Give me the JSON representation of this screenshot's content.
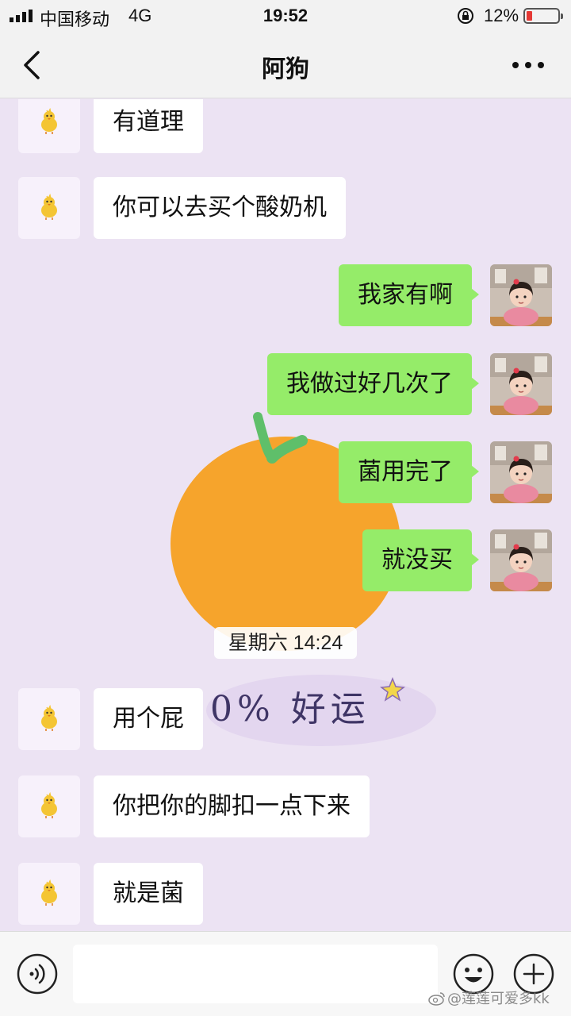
{
  "status_bar": {
    "carrier": "中国移动",
    "network": "4G",
    "time": "19:52",
    "battery_percent": "12%",
    "battery_level": 0.12,
    "battery_color": "#e53935"
  },
  "nav": {
    "title": "阿狗",
    "back_icon": "chevron-left-icon",
    "more_icon": "more-dots-icon"
  },
  "messages": [
    {
      "side": "left",
      "text": "有道理"
    },
    {
      "side": "left",
      "text": "你可以去买个酸奶机"
    },
    {
      "side": "right",
      "text": "我家有啊"
    },
    {
      "side": "right",
      "text": "我做过好几次了"
    },
    {
      "side": "right",
      "text": "菌用完了"
    },
    {
      "side": "right",
      "text": "就没买"
    },
    {
      "side": "left",
      "text": "用个屁"
    },
    {
      "side": "left",
      "text": "你把你的脚扣一点下来"
    },
    {
      "side": "left",
      "text": "就是菌"
    }
  ],
  "timestamp": "星期六 14:24",
  "background_sticker": {
    "text": "0% 好运"
  },
  "input_bar": {
    "placeholder": "",
    "voice_icon": "voice-icon",
    "emoji_icon": "emoji-icon",
    "plus_icon": "plus-icon"
  },
  "watermark": "@莲莲可爱多kk",
  "colors": {
    "background": "#ece3f3",
    "own_bubble": "#95ec69",
    "other_bubble": "#ffffff",
    "orange": "#f6a42c"
  }
}
